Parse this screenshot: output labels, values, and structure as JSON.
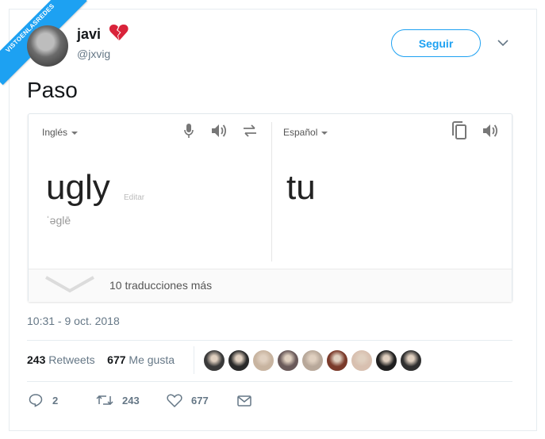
{
  "watermark": {
    "line1": "VISTOENLASREDES",
    "line2": ".com"
  },
  "author": {
    "name": "javi",
    "handle": "@jxvig",
    "emoji": "broken-heart"
  },
  "header": {
    "follow_label": "Seguir"
  },
  "tweet": {
    "text": "Paso"
  },
  "translate": {
    "source_lang": "Inglés",
    "target_lang": "Español",
    "source_text": "ugly",
    "edit_label": "Editar",
    "phonetic": "ˈəglē",
    "target_text": "tu",
    "more_translations": "10 traducciones más"
  },
  "meta": {
    "timestamp": "10:31 - 9 oct. 2018"
  },
  "stats": {
    "retweets_count": "243",
    "retweets_label": "Retweets",
    "likes_count": "677",
    "likes_label": "Me gusta"
  },
  "likers_colors": [
    "#3a3a3a",
    "#2a2a2a",
    "#c8b4a0",
    "#6a5a5a",
    "#b8a89a",
    "#7a3a2a",
    "#d8c0b0",
    "#1f1f1f",
    "#2f2f2f"
  ],
  "actions": {
    "replies": "2",
    "retweets": "243",
    "likes": "677"
  },
  "colors": {
    "accent": "#1da1f2",
    "muted": "#657786"
  }
}
